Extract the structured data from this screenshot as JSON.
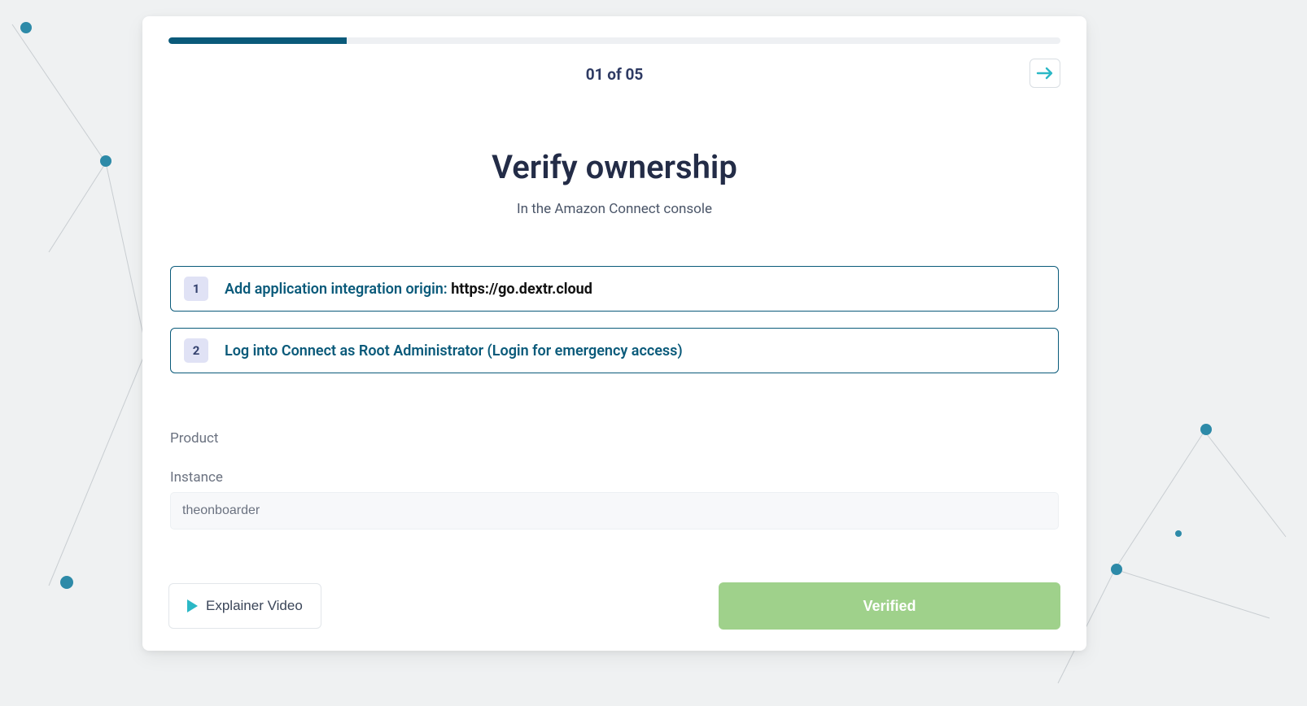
{
  "progress": {
    "percent": 20,
    "step_label": "01 of 05"
  },
  "headline": {
    "title": "Verify ownership",
    "subtitle": "In the Amazon Connect console"
  },
  "instructions": [
    {
      "num": "1",
      "text_prefix": "Add application integration origin: ",
      "text_accent": "https://go.dextr.cloud"
    },
    {
      "num": "2",
      "text_prefix": "Log into Connect as Root Administrator (Login for emergency access)",
      "text_accent": ""
    }
  ],
  "form": {
    "product_label": "Product",
    "instance_label": "Instance",
    "instance_value": "theonboarder"
  },
  "footer": {
    "explainer_label": "Explainer Video",
    "verified_label": "Verified"
  },
  "colors": {
    "accent": "#0a5a7a",
    "cyan": "#2bb8c6",
    "success": "#9fd18b"
  }
}
